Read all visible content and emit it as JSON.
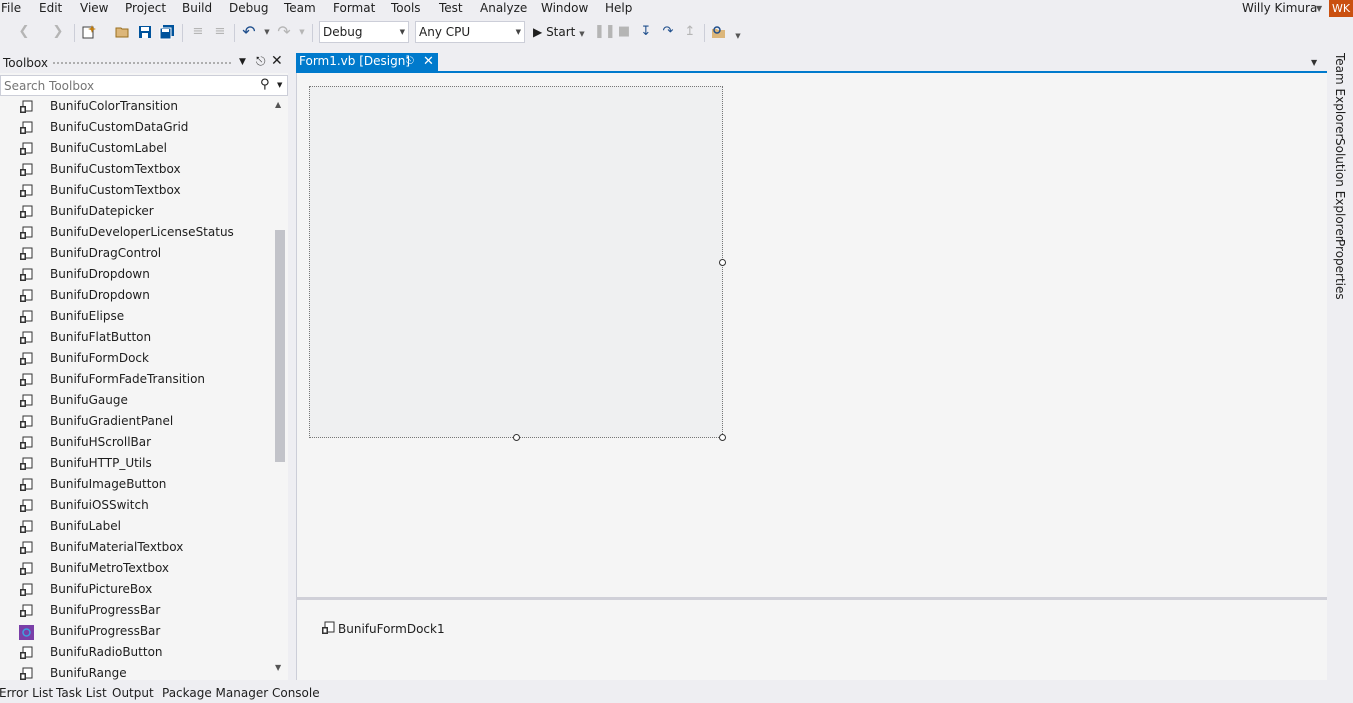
{
  "menu": {
    "items": [
      "File",
      "Edit",
      "View",
      "Project",
      "Build",
      "Debug",
      "Team",
      "Format",
      "Tools",
      "Test",
      "Analyze",
      "Window",
      "Help"
    ],
    "user_name": "Willy Kimura",
    "user_initials": "WK"
  },
  "toolbar": {
    "configuration": "Debug",
    "platform": "Any CPU",
    "start_label": "Start"
  },
  "toolbox": {
    "title": "Toolbox",
    "search_placeholder": "Search Toolbox",
    "items": [
      "BunifuColorTransition",
      "BunifuCustomDataGrid",
      "BunifuCustomLabel",
      "BunifuCustomTextbox",
      "BunifuCustomTextbox",
      "BunifuDatepicker",
      "BunifuDeveloperLicenseStatus",
      "BunifuDragControl",
      "BunifuDropdown",
      "BunifuDropdown",
      "BunifuElipse",
      "BunifuFlatButton",
      "BunifuFormDock",
      "BunifuFormFadeTransition",
      "BunifuGauge",
      "BunifuGradientPanel",
      "BunifuHScrollBar",
      "BunifuHTTP_Utils",
      "BunifuImageButton",
      "BunifuiOSSwitch",
      "BunifuLabel",
      "BunifuMaterialTextbox",
      "BunifuMetroTextbox",
      "BunifuPictureBox",
      "BunifuProgressBar",
      "BunifuProgressBar",
      "BunifuRadioButton",
      "BunifuRange"
    ]
  },
  "document": {
    "tab_label": "Form1.vb [Design]"
  },
  "component_tray": {
    "item": "BunifuFormDock1"
  },
  "side_tabs": [
    "Team Explorer",
    "Solution Explorer",
    "Properties"
  ],
  "bottom_tabs": [
    "Error List",
    "Task List",
    "Output",
    "Package Manager Console"
  ],
  "colors": {
    "accent": "#007acc",
    "avatar": "#ca5010"
  }
}
